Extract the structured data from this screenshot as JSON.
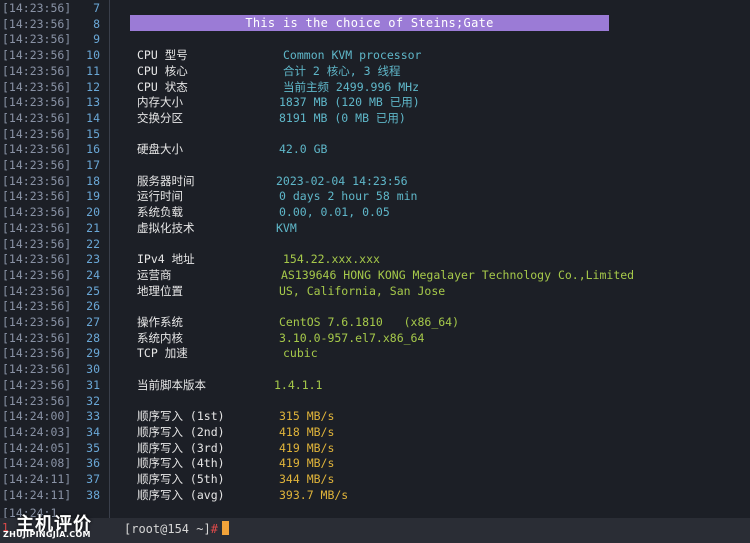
{
  "terminal": {
    "banner": "This is the choice of Steins;Gate",
    "gutter": [
      {
        "ts": "[14:23:56]",
        "ln": "7"
      },
      {
        "ts": "[14:23:56]",
        "ln": "8"
      },
      {
        "ts": "[14:23:56]",
        "ln": "9"
      },
      {
        "ts": "[14:23:56]",
        "ln": "10"
      },
      {
        "ts": "[14:23:56]",
        "ln": "11"
      },
      {
        "ts": "[14:23:56]",
        "ln": "12"
      },
      {
        "ts": "[14:23:56]",
        "ln": "13"
      },
      {
        "ts": "[14:23:56]",
        "ln": "14"
      },
      {
        "ts": "[14:23:56]",
        "ln": "15"
      },
      {
        "ts": "[14:23:56]",
        "ln": "16"
      },
      {
        "ts": "[14:23:56]",
        "ln": "17"
      },
      {
        "ts": "[14:23:56]",
        "ln": "18"
      },
      {
        "ts": "[14:23:56]",
        "ln": "19"
      },
      {
        "ts": "[14:23:56]",
        "ln": "20"
      },
      {
        "ts": "[14:23:56]",
        "ln": "21"
      },
      {
        "ts": "[14:23:56]",
        "ln": "22"
      },
      {
        "ts": "[14:23:56]",
        "ln": "23"
      },
      {
        "ts": "[14:23:56]",
        "ln": "24"
      },
      {
        "ts": "[14:23:56]",
        "ln": "25"
      },
      {
        "ts": "[14:23:56]",
        "ln": "26"
      },
      {
        "ts": "[14:23:56]",
        "ln": "27"
      },
      {
        "ts": "[14:23:56]",
        "ln": "28"
      },
      {
        "ts": "[14:23:56]",
        "ln": "29"
      },
      {
        "ts": "[14:23:56]",
        "ln": "30"
      },
      {
        "ts": "[14:23:56]",
        "ln": "31"
      },
      {
        "ts": "[14:23:56]",
        "ln": "32"
      },
      {
        "ts": "[14:24:00]",
        "ln": "33"
      },
      {
        "ts": "[14:24:03]",
        "ln": "34"
      },
      {
        "ts": "[14:24:05]",
        "ln": "35"
      },
      {
        "ts": "[14:24:08]",
        "ln": "36"
      },
      {
        "ts": "[14:24:11]",
        "ln": "37"
      },
      {
        "ts": "[14:24:11]",
        "ln": "38"
      }
    ],
    "info": [
      {
        "label": "CPU 型号",
        "value": "Common KVM processor",
        "color": "cyan"
      },
      {
        "label": "CPU 核心",
        "value": "合计 2 核心, 3 线程",
        "color": "cyan"
      },
      {
        "label": "CPU 状态",
        "value": "当前主频 2499.996 MHz",
        "color": "cyan"
      },
      {
        "label": "内存大小",
        "value": "1837 MB (120 MB 已用)",
        "color": "cyan"
      },
      {
        "label": "交换分区",
        "value": "8191 MB (0 MB 已用)",
        "color": "cyan"
      },
      {
        "label": "硬盘大小",
        "value": "42.0 GB",
        "color": "cyan"
      },
      {
        "label": "服务器时间",
        "value": "2023-02-04 14:23:56",
        "color": "cyan"
      },
      {
        "label": "运行时间",
        "value": "0 days 2 hour 58 min",
        "color": "cyan"
      },
      {
        "label": "系统负载",
        "value": "0.00, 0.01, 0.05",
        "color": "cyan"
      },
      {
        "label": "虚拟化技术",
        "value": "KVM",
        "color": "cyan"
      },
      {
        "label": "IPv4 地址",
        "value": "154.22.xxx.xxx",
        "color": "green"
      },
      {
        "label": "运营商",
        "value": "AS139646 HONG KONG Megalayer Technology Co.,Limited",
        "color": "green"
      },
      {
        "label": "地理位置",
        "value": "US, California, San Jose",
        "color": "green"
      },
      {
        "label": "操作系统",
        "value": "CentOS 7.6.1810   (x86_64)",
        "color": "green"
      },
      {
        "label": "系统内核",
        "value": "3.10.0-957.el7.x86_64",
        "color": "green"
      },
      {
        "label": "TCP 加速",
        "value": "cubic",
        "color": "green"
      },
      {
        "label": "当前脚本版本",
        "value": "1.4.1.1",
        "color": "green"
      },
      {
        "label": "顺序写入 (1st)",
        "value": "315 MB/s",
        "color": "yellow"
      },
      {
        "label": "顺序写入 (2nd)",
        "value": "418 MB/s",
        "color": "yellow"
      },
      {
        "label": "顺序写入 (3rd)",
        "value": "419 MB/s",
        "color": "yellow"
      },
      {
        "label": "顺序写入 (4th)",
        "value": "419 MB/s",
        "color": "yellow"
      },
      {
        "label": "顺序写入 (5th)",
        "value": "344 MB/s",
        "color": "yellow"
      },
      {
        "label": "顺序写入 (avg)",
        "value": "393.7 MB/s",
        "color": "yellow"
      }
    ],
    "partial_ts": "[14:24:1",
    "partial_ln": "1",
    "prompt": "[root@154 ~]",
    "prompt_hash": "#"
  },
  "watermark": {
    "text": "主机评价",
    "sub": "ZHUJIPINGJIA.COM"
  },
  "colors": {
    "background": "#1c1f26",
    "banner": "#9b7bd6",
    "cyan": "#5fb7c9",
    "green": "#a6c94a",
    "yellow": "#e0b43a",
    "cursor": "#f2a33a"
  }
}
